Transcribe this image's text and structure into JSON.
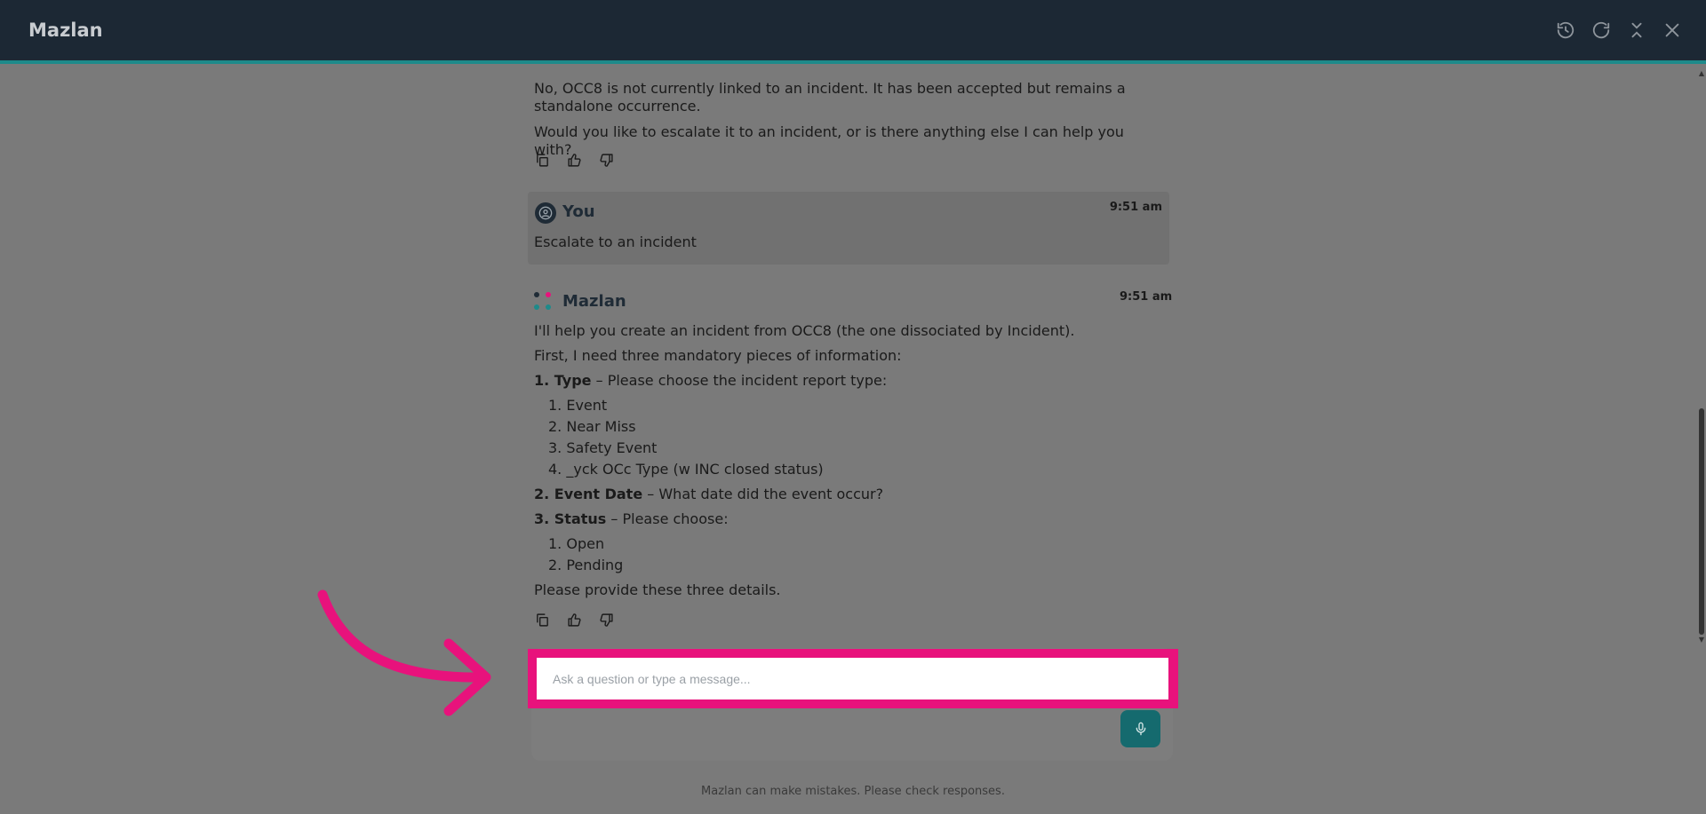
{
  "header": {
    "title": "Mazlan",
    "actions": [
      "history-icon",
      "refresh-icon",
      "collapse-icon",
      "close-icon"
    ]
  },
  "messages": {
    "previous_bot": {
      "line1": "No, OCC8 is not currently linked to an incident. It has been accepted but remains a standalone occurrence.",
      "line2": "Would you like to escalate it to an incident, or is there anything else I can help you with?"
    },
    "user": {
      "sender": "You",
      "time": "9:51 am",
      "text": "Escalate to an incident"
    },
    "bot": {
      "sender": "Mazlan",
      "time": "9:51 am",
      "intro": "I'll help you create an incident from OCC8 (the one dissociated by Incident).",
      "first": "First, I need three mandatory pieces of information:",
      "q1_label": "1. Type",
      "q1_text": " – Please choose the incident report type:",
      "q1_options": [
        "1. Event",
        "2. Near Miss",
        "3. Safety Event",
        "4. _yck OCc Type (w INC closed status)"
      ],
      "q2_label": "2. Event Date",
      "q2_text": " – What date did the event occur?",
      "q3_label": "3. Status",
      "q3_text": " – Please choose:",
      "q3_options": [
        "1. Open",
        "2. Pending"
      ],
      "closing": "Please provide these three details."
    }
  },
  "input": {
    "placeholder": "Ask a question or type a message..."
  },
  "disclaimer": "Mazlan can make mistakes. Please check responses.",
  "colors": {
    "header_bg": "#1c2834",
    "accent": "#1e8a8a",
    "highlight": "#e8127c",
    "mic_bg": "#156a6e"
  }
}
